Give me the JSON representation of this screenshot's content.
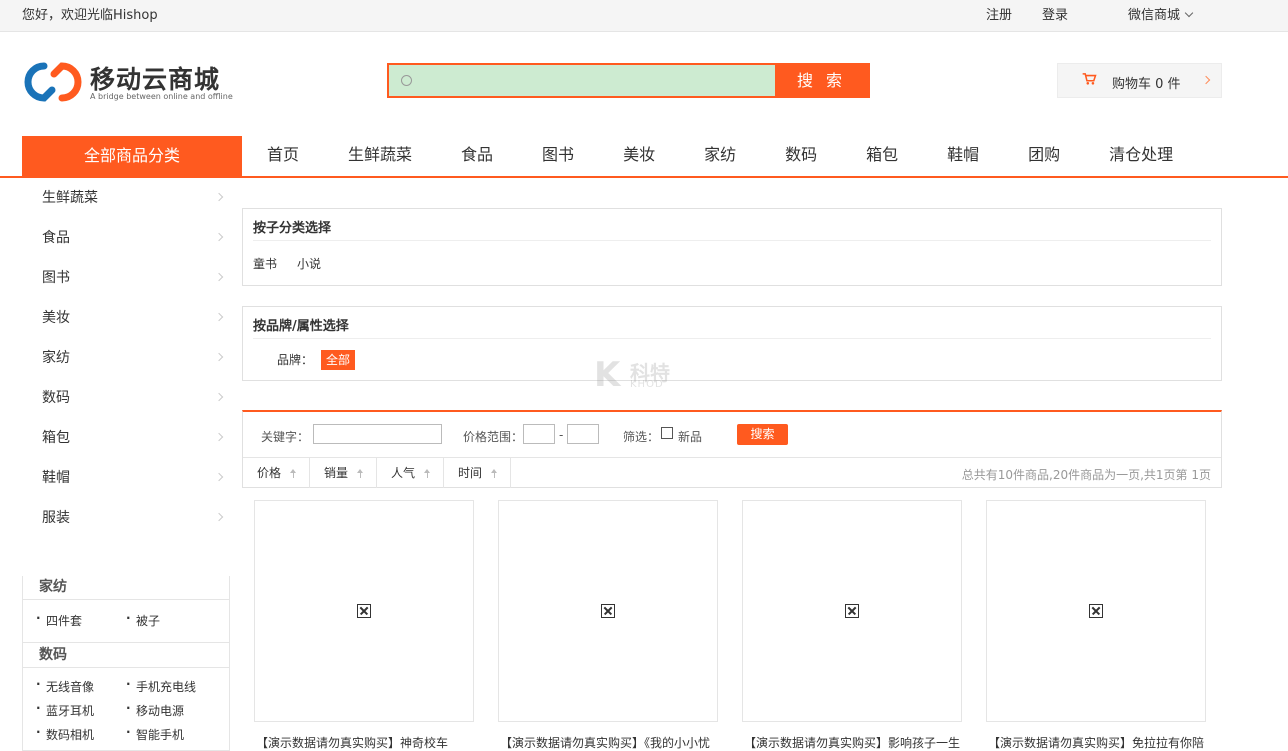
{
  "topbar": {
    "welcome": "您好，欢迎光临Hishop",
    "register": "注册",
    "login": "登录",
    "wechat_mall": "微信商城"
  },
  "logo": {
    "name": "移动云商城",
    "tagline": "A bridge between online and offline"
  },
  "search": {
    "placeholder": "",
    "button": "搜 索"
  },
  "cart": {
    "label": "购物车 0 件"
  },
  "nav": {
    "all_categories": "全部商品分类",
    "items": [
      "首页",
      "生鲜蔬菜",
      "食品",
      "图书",
      "美妆",
      "家纺",
      "数码",
      "箱包",
      "鞋帽",
      "团购",
      "清仓处理"
    ]
  },
  "category_menu": [
    "生鲜蔬菜",
    "食品",
    "图书",
    "美妆",
    "家纺",
    "数码",
    "箱包",
    "鞋帽",
    "服装"
  ],
  "sidebar": {
    "sections": [
      {
        "title": "家纺",
        "links": [
          "四件套",
          "被子"
        ]
      },
      {
        "title": "数码",
        "links": [
          "无线音像",
          "手机充电线",
          "蓝牙耳机",
          "移动电源",
          "数码相机",
          "智能手机"
        ]
      }
    ]
  },
  "child_category": {
    "title": "按子分类选择",
    "links": [
      "童书",
      "小说"
    ]
  },
  "brand_filter": {
    "title": "按品牌/属性选择",
    "label": "品牌：",
    "selected": "全部"
  },
  "filter": {
    "keyword_label": "关键字：",
    "price_label": "价格范围：",
    "dash": "-",
    "screen_label": "筛选：",
    "new_label": "新品",
    "search_button": "搜索",
    "sort": [
      "价格",
      "销量",
      "人气",
      "时间"
    ],
    "page_info": "总共有10件商品,20件商品为一页,共1页第 1页"
  },
  "products": [
    {
      "title": "【演示数据请勿真实购买】神奇校车"
    },
    {
      "title": "【演示数据请勿真实购买】《我的小小忧"
    },
    {
      "title": "【演示数据请勿真实购买】影响孩子一生"
    },
    {
      "title": "【演示数据请勿真实购买】免拉拉有你陪"
    }
  ],
  "watermark": {
    "letter": "K",
    "text": "科特",
    "sub": "KHOD"
  },
  "colors": {
    "accent": "#ff5a1f",
    "search_fill": "#cdebd1"
  }
}
